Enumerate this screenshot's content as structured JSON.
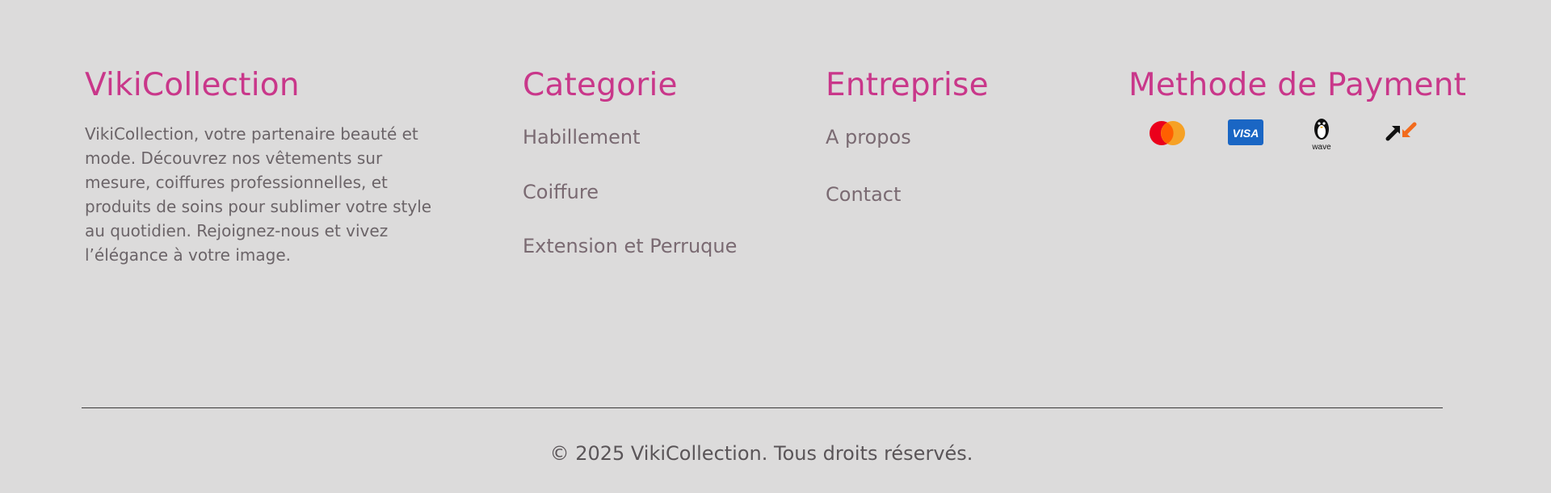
{
  "brand": {
    "title": "VikiCollection",
    "description": "VikiCollection, votre partenaire beauté et mode. Découvrez nos vêtements sur mesure, coiffures professionnelles, et produits de soins pour sublimer votre style au quotidien. Rejoignez-nous et vivez l’élégance à votre image."
  },
  "categorie": {
    "heading": "Categorie",
    "links": [
      "Habillement",
      "Coiffure",
      "Extension et Perruque"
    ]
  },
  "entreprise": {
    "heading": "Entreprise",
    "links": [
      "A propos",
      "Contact"
    ]
  },
  "payment": {
    "heading": "Methode de Payment",
    "icons": [
      {
        "name": "mastercard-icon"
      },
      {
        "name": "visa-icon",
        "text": "VISA"
      },
      {
        "name": "wave-icon",
        "text": "wave"
      },
      {
        "name": "orange-money-icon"
      }
    ]
  },
  "colors": {
    "accent": "#c9378a",
    "background": "#dcdbdb"
  },
  "footer": {
    "copyright": "© 2025 VikiCollection. Tous droits réservés."
  }
}
